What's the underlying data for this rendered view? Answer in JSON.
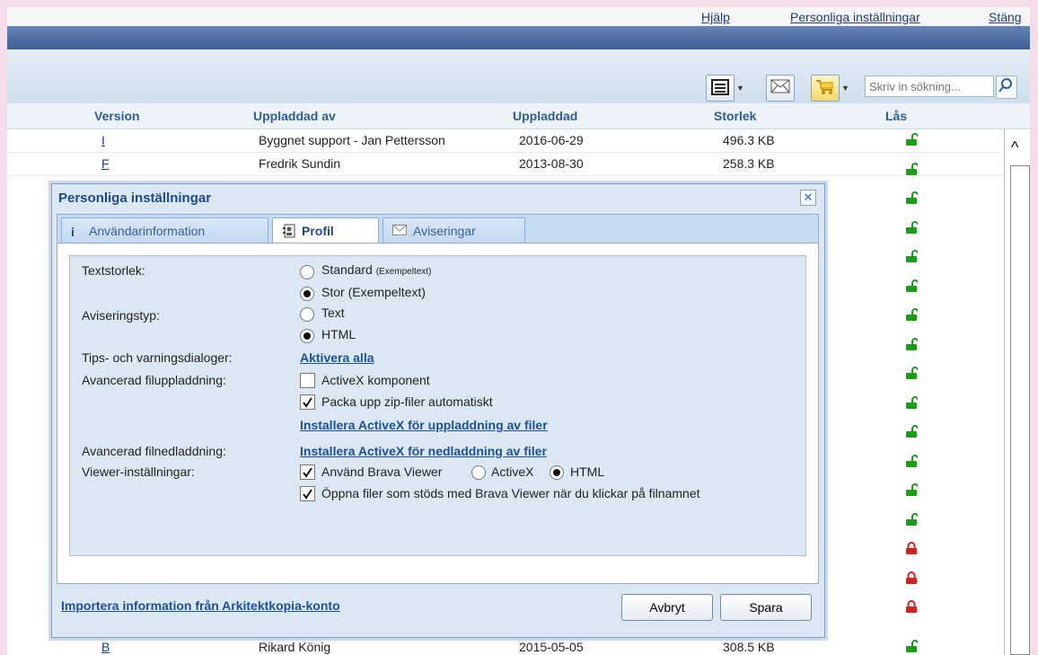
{
  "top_links": {
    "help": "Hjälp",
    "personal_settings": "Personliga inställningar",
    "close": "Stäng"
  },
  "toolbar": {
    "search_placeholder": "Skriv in sökning..."
  },
  "table": {
    "headers": {
      "version": "Version",
      "uploaded_by": "Uppladdad av",
      "uploaded": "Uppladdad",
      "size": "Storlek",
      "lock": "Lås"
    },
    "rows": [
      {
        "version": "I",
        "uploaded_by": "Byggnet support - Jan Pettersson",
        "uploaded": "2016-06-29",
        "size": "496.3 KB",
        "lock": "open"
      },
      {
        "version": "F",
        "uploaded_by": "Fredrik Sundin",
        "uploaded": "2013-08-30",
        "size": "258.3 KB",
        "lock": "open"
      }
    ],
    "last_row": {
      "version": "B",
      "uploaded_by": "Rikard König",
      "uploaded": "2015-05-05",
      "size": "308.5 KB",
      "lock": "open"
    },
    "side_locks": [
      "open",
      "open",
      "open",
      "open",
      "open",
      "open",
      "open",
      "open",
      "open",
      "open",
      "open",
      "open",
      "open",
      "open",
      "closed",
      "closed",
      "closed"
    ],
    "colors": {
      "open": "#1a9e1a",
      "closed": "#d42020"
    }
  },
  "dialog": {
    "title": "Personliga inställningar",
    "tabs": [
      {
        "label": "Användarinformation",
        "icon": "info-icon"
      },
      {
        "label": "Profil",
        "icon": "profile-icon"
      },
      {
        "label": "Aviseringar",
        "icon": "envelope-icon"
      }
    ],
    "text_size": {
      "label": "Textstorlek:",
      "standard": "Standard",
      "standard_example": "(Exempeltext)",
      "large": "Stor (Exempeltext)",
      "selected": "large"
    },
    "notification_type": {
      "label": "Aviseringstyp:",
      "text": "Text",
      "html": "HTML",
      "selected": "html"
    },
    "tips": {
      "label": "Tips- och varningsdialoger:",
      "link": "Aktivera alla"
    },
    "adv_upload": {
      "label": "Avancerad filuppladdning:",
      "activex": "ActiveX komponent",
      "activex_checked": false,
      "unzip": "Packa upp zip-filer automatiskt",
      "unzip_checked": true,
      "install_link": "Installera ActiveX för uppladdning av filer"
    },
    "adv_download": {
      "label": "Avancerad filnedladdning:",
      "install_link": "Installera ActiveX för nedladdning av filer"
    },
    "viewer": {
      "label": "Viewer-inställningar:",
      "use_brava": "Använd Brava Viewer",
      "activex": "ActiveX",
      "html": "HTML",
      "selected": "html",
      "open_files": "Öppna filer som stöds med Brava Viewer när du klickar på filnamnet"
    },
    "import_link": "Importera information från Arkitektkopia-konto",
    "cancel": "Avbryt",
    "save": "Spara"
  }
}
